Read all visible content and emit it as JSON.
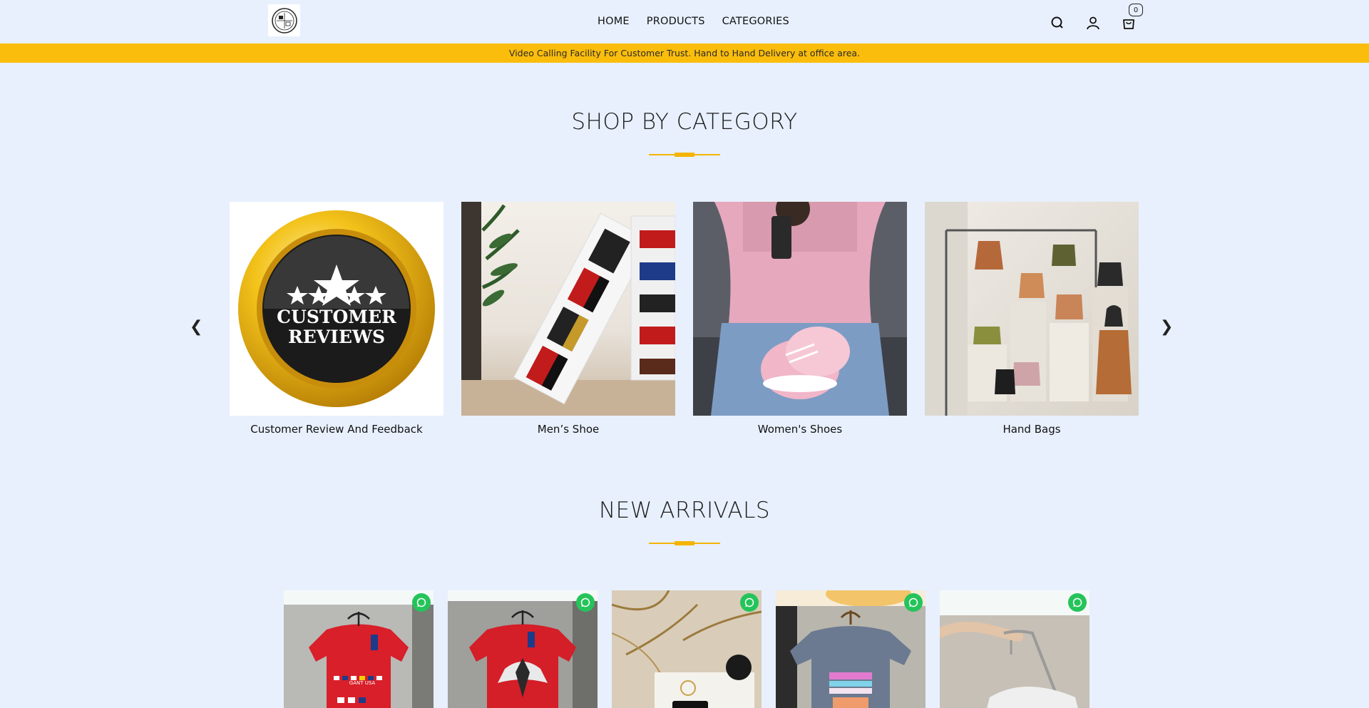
{
  "header": {
    "logo_alt": "store logo",
    "nav": [
      {
        "label": "HOME"
      },
      {
        "label": "PRODUCTS"
      },
      {
        "label": "CATEGORIES"
      }
    ],
    "cart_count": "0",
    "icons": [
      "search-icon",
      "user-icon",
      "cart-icon"
    ]
  },
  "announcement": "Video Calling Facility For Customer Trust. Hand to Hand Delivery at office area.",
  "shop_by_category": {
    "title": "SHOP BY CATEGORY",
    "prev_arrow": "❮",
    "next_arrow": "❯",
    "categories": [
      {
        "label": "Customer Review And Feedback",
        "badge_line1": "CUSTOMER",
        "badge_line2": "REVIEWS"
      },
      {
        "label": "Men’s Shoe"
      },
      {
        "label": "Women's Shoes"
      },
      {
        "label": "Hand Bags"
      }
    ]
  },
  "new_arrivals": {
    "title": "NEW ARRIVALS",
    "products": [
      {
        "name": "red-gant-tshirt",
        "tag_text": "GANT USA"
      },
      {
        "name": "red-eagle-tshirt"
      },
      {
        "name": "tory-burch-wallet"
      },
      {
        "name": "grey-graphic-tshirt"
      },
      {
        "name": "white-shoulder-bag"
      }
    ]
  },
  "colors": {
    "background": "#e8f0fd",
    "accent": "#fbbd0c",
    "whatsapp": "#25c45a"
  }
}
